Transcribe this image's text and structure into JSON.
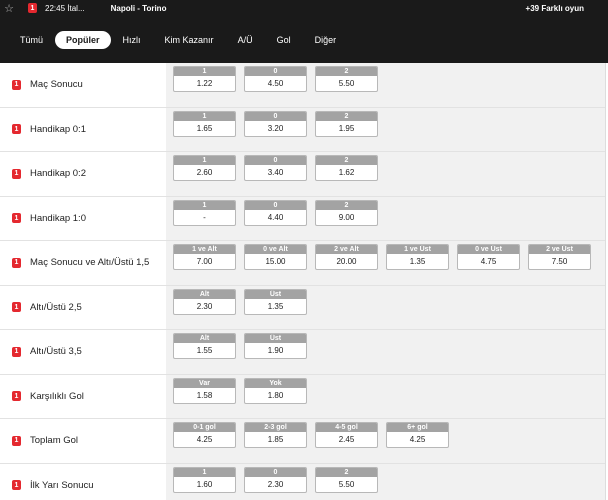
{
  "topbar": {
    "star_icon": "star-icon",
    "badge": "1",
    "time": "22:45",
    "league": "İtal...",
    "match": "Napoli - Torino",
    "more_games": "+39 Farklı oyun"
  },
  "tabs": [
    "Tümü",
    "Popüler",
    "Hızlı",
    "Kim Kazanır",
    "A/Ü",
    "Gol",
    "Diğer"
  ],
  "active_tab": "Popüler",
  "markets": [
    {
      "title": "Maç Sonucu",
      "badge": "1",
      "odds": [
        {
          "h": "1",
          "v": "1.22"
        },
        {
          "h": "0",
          "v": "4.50"
        },
        {
          "h": "2",
          "v": "5.50"
        }
      ]
    },
    {
      "title": "Handikap 0:1",
      "badge": "1",
      "odds": [
        {
          "h": "1",
          "v": "1.65"
        },
        {
          "h": "0",
          "v": "3.20"
        },
        {
          "h": "2",
          "v": "1.95"
        }
      ]
    },
    {
      "title": "Handikap 0:2",
      "badge": "1",
      "odds": [
        {
          "h": "1",
          "v": "2.60"
        },
        {
          "h": "0",
          "v": "3.40"
        },
        {
          "h": "2",
          "v": "1.62"
        }
      ]
    },
    {
      "title": "Handikap 1:0",
      "badge": "1",
      "odds": [
        {
          "h": "1",
          "v": "-"
        },
        {
          "h": "0",
          "v": "4.40"
        },
        {
          "h": "2",
          "v": "9.00"
        }
      ]
    },
    {
      "title": "Maç Sonucu ve Altı/Üstü 1,5",
      "badge": "1",
      "odds": [
        {
          "h": "1 ve Alt",
          "v": "7.00"
        },
        {
          "h": "0 ve Alt",
          "v": "15.00"
        },
        {
          "h": "2 ve Alt",
          "v": "20.00"
        },
        {
          "h": "1 ve Üst",
          "v": "1.35"
        },
        {
          "h": "0 ve Üst",
          "v": "4.75"
        },
        {
          "h": "2 ve Üst",
          "v": "7.50"
        }
      ]
    },
    {
      "title": "Altı/Üstü 2,5",
      "badge": "1",
      "odds": [
        {
          "h": "Alt",
          "v": "2.30"
        },
        {
          "h": "Üst",
          "v": "1.35"
        }
      ]
    },
    {
      "title": "Altı/Üstü 3,5",
      "badge": "1",
      "odds": [
        {
          "h": "Alt",
          "v": "1.55"
        },
        {
          "h": "Üst",
          "v": "1.90"
        }
      ]
    },
    {
      "title": "Karşılıklı Gol",
      "badge": "1",
      "odds": [
        {
          "h": "Var",
          "v": "1.58"
        },
        {
          "h": "Yok",
          "v": "1.80"
        }
      ]
    },
    {
      "title": "Toplam Gol",
      "badge": "1",
      "odds": [
        {
          "h": "0-1 gol",
          "v": "4.25"
        },
        {
          "h": "2-3 gol",
          "v": "1.85"
        },
        {
          "h": "4-5 gol",
          "v": "2.45"
        },
        {
          "h": "6+ gol",
          "v": "4.25"
        }
      ]
    },
    {
      "title": "İlk Yarı Sonucu",
      "badge": "1",
      "odds": [
        {
          "h": "1",
          "v": "1.60"
        },
        {
          "h": "0",
          "v": "2.30"
        },
        {
          "h": "2",
          "v": "5.50"
        }
      ]
    }
  ]
}
